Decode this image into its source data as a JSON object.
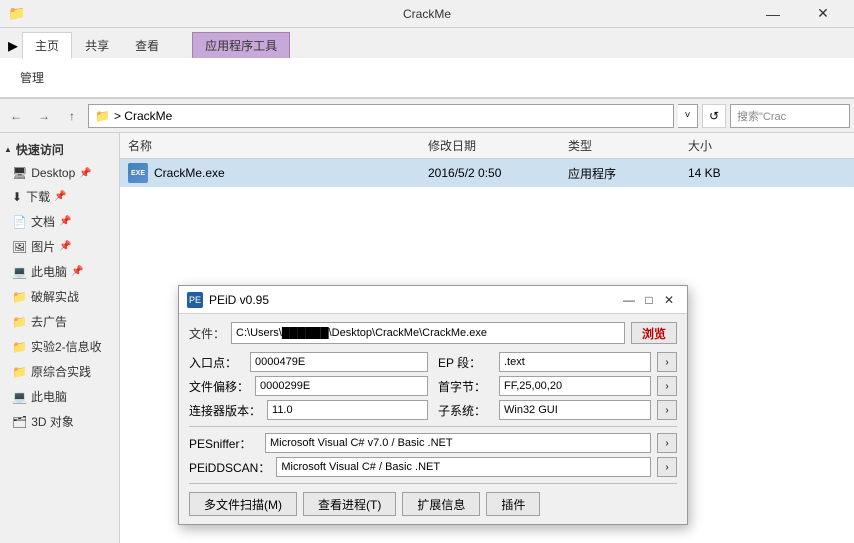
{
  "desktop": {
    "bg_colors": [
      "#6a3d8f",
      "#a0522d",
      "#c8a060",
      "#7a9abf"
    ]
  },
  "explorer": {
    "title": "CrackMe",
    "title_bar": {
      "minimize": "—",
      "close": "✕"
    },
    "ribbon": {
      "app_btn_icon": "▼",
      "tabs": [
        {
          "label": "主页",
          "active": true
        },
        {
          "label": "共享",
          "active": false
        },
        {
          "label": "查看",
          "active": false
        }
      ],
      "context_tab": "应用程序工具",
      "context_subtab": "管理"
    },
    "breadcrumb": {
      "path_icon": "📁",
      "path": "> CrackMe",
      "chevron": "˅",
      "refresh_icon": "↺",
      "search_placeholder": "搜索\"Crac"
    },
    "columns": {
      "name": "名称",
      "date": "修改日期",
      "type": "类型",
      "size": "大小"
    },
    "files": [
      {
        "name": "CrackMe.exe",
        "date": "2016/5/2 0:50",
        "type": "应用程序",
        "size": "14 KB"
      }
    ],
    "sidebar": {
      "section_quick": "快速访问",
      "items": [
        {
          "label": "Desktop",
          "pinned": true
        },
        {
          "label": "下载",
          "pinned": true
        },
        {
          "label": "文档",
          "pinned": true
        },
        {
          "label": "图片",
          "pinned": true
        },
        {
          "label": "此电脑",
          "pinned": true
        },
        {
          "label": "破解实战"
        },
        {
          "label": "去广告"
        },
        {
          "label": "实验2-信息收"
        },
        {
          "label": "原综合实践"
        },
        {
          "label": "此电脑"
        },
        {
          "label": "3D 对象"
        }
      ]
    }
  },
  "peid": {
    "title": "PEiD v0.95",
    "title_icon": "PE",
    "controls": {
      "minimize": "—",
      "maximize": "□",
      "close": "✕"
    },
    "file_label": "文件：",
    "file_path": "C:\\Users\\██████\\Desktop\\CrackMe\\CrackMe.exe",
    "browse_btn": "浏览",
    "fields": {
      "entry_point_label": "入口点：",
      "entry_point_value": "0000479E",
      "ep_section_label": "EP 段：",
      "ep_section_value": ".text",
      "file_offset_label": "文件偏移：",
      "file_offset_value": "0000299E",
      "first_byte_label": "首字节：",
      "first_byte_value": "FF,25,00,20",
      "linker_label": "连接器版本：",
      "linker_value": "11.0",
      "subsystem_label": "子系统：",
      "subsystem_value": "Win32 GUI"
    },
    "sniffer": {
      "pesniffer_label": "PESniffer：",
      "pesniffer_value": "Microsoft Visual C# v7.0 / Basic .NET",
      "peiddscan_label": "PEiDDSCAN：",
      "peiddscan_value": "Microsoft Visual C# / Basic .NET"
    },
    "bottom_btns": [
      {
        "label": "多文件扫描(M)",
        "id": "multi-scan"
      },
      {
        "label": "查看进程(T)",
        "id": "view-process"
      },
      {
        "label": "扩展信息",
        "id": "extended-info"
      },
      {
        "label": "插件",
        "id": "plugins"
      }
    ]
  }
}
